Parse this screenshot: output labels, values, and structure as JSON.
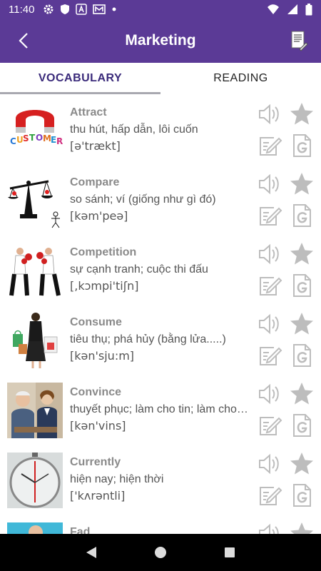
{
  "status": {
    "time": "11:40",
    "icons_left": [
      "gear-icon",
      "shield-icon",
      "a-icon",
      "mail-icon",
      "dot-icon"
    ],
    "icons_right": [
      "wifi-icon",
      "signal-icon",
      "battery-icon"
    ]
  },
  "app_bar": {
    "title": "Marketing",
    "color": "#5b3a96"
  },
  "tabs": [
    {
      "label": "VOCABULARY",
      "active": true
    },
    {
      "label": "READING",
      "active": false
    }
  ],
  "words": [
    {
      "title": "Attract",
      "meaning": "thu hút, hấp dẫn, lôi cuốn",
      "ipa": "[ə'trækt]",
      "image": "magnet-customer-image"
    },
    {
      "title": "Compare",
      "meaning": "so sánh; ví (giống như gì đó)",
      "ipa": "[kəm'peə]",
      "image": "balance-scale-image"
    },
    {
      "title": "Competition",
      "meaning": "sự cạnh tranh; cuộc thi đấu",
      "ipa": "[,kɔmpi'tiʃn]",
      "image": "boxing-businessmen-image"
    },
    {
      "title": "Consume",
      "meaning": "tiêu thụ; phá hủy (bằng lửa.....)",
      "ipa": "[kən'sju:m]",
      "image": "shopping-bags-image"
    },
    {
      "title": "Convince",
      "meaning": "thuyết phục; làm cho tin; làm cho nhận thức thấy",
      "ipa": "[kən'vins]",
      "image": "meeting-people-image"
    },
    {
      "title": "Currently",
      "meaning": "hiện nay; hiện thời",
      "ipa": "['kʌrəntli]",
      "image": "clock-present-image"
    },
    {
      "title": "Fad",
      "meaning": "",
      "ipa": "",
      "image": "partial-image"
    }
  ],
  "actions": [
    "speaker-icon",
    "star-icon",
    "note-edit-icon",
    "google-doc-icon"
  ],
  "nav": [
    "back-triangle-icon",
    "home-circle-icon",
    "recents-square-icon"
  ]
}
